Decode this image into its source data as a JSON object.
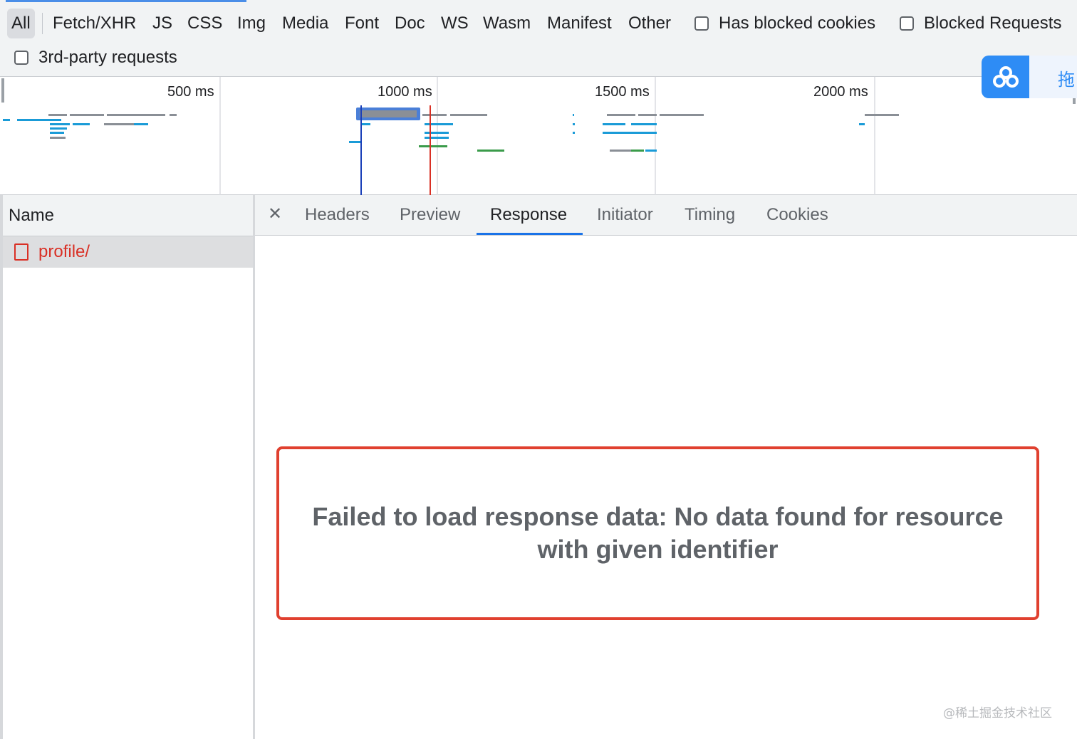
{
  "filters": {
    "types": [
      "All",
      "Fetch/XHR",
      "JS",
      "CSS",
      "Img",
      "Media",
      "Font",
      "Doc",
      "WS",
      "Wasm",
      "Manifest",
      "Other"
    ],
    "active": "All",
    "has_blocked_cookies": "Has blocked cookies",
    "blocked_requests": "Blocked Requests",
    "third_party": "3rd-party requests"
  },
  "overview": {
    "ticks": [
      "500 ms",
      "1000 ms",
      "1500 ms",
      "2000 ms"
    ]
  },
  "floating_widget": {
    "label": "拖"
  },
  "requests": {
    "column_name": "Name",
    "items": [
      {
        "name": "profile/",
        "status": "failed"
      }
    ]
  },
  "detail": {
    "tabs": [
      "Headers",
      "Preview",
      "Response",
      "Initiator",
      "Timing",
      "Cookies"
    ],
    "active_tab": "Response",
    "message": "Failed to load response data: No data found for resource with given identifier"
  },
  "watermark": "@稀土掘金技术社区",
  "colors": {
    "accent": "#1a73e8",
    "error": "#d93025",
    "highlight_border": "#e0402f",
    "widget": "#2e8cf5"
  }
}
